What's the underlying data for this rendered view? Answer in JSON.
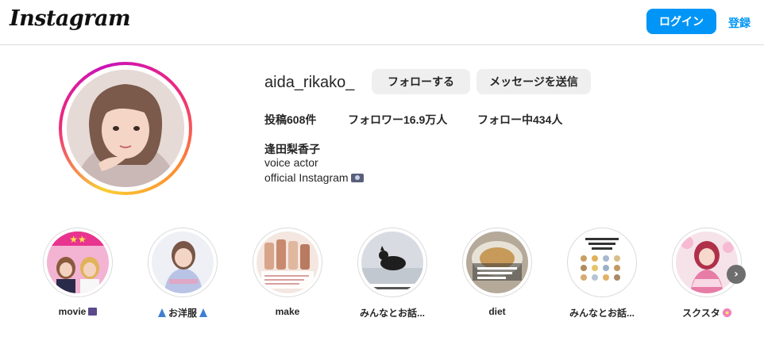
{
  "header": {
    "logo_text": "Instagram",
    "login_label": "ログイン",
    "signup_label": "登録",
    "accent_color": "#0095f6"
  },
  "profile": {
    "username": "aida_rikako_",
    "follow_label": "フォローする",
    "message_label": "メッセージを送信",
    "stats": {
      "posts": "投稿608件",
      "followers": "フォロワー16.9万人",
      "following": "フォロー中434人"
    },
    "full_name": "逢田梨香子",
    "bio_line1": "voice actor",
    "bio_line2": "official Instagram",
    "bio_icon": "camera-icon"
  },
  "highlights": [
    {
      "label": "movie",
      "emoji": "clapper-board-icon"
    },
    {
      "label": "お洋服",
      "emoji": "dress-icon"
    },
    {
      "label": "make",
      "emoji": ""
    },
    {
      "label": "みんなとお話...",
      "emoji": ""
    },
    {
      "label": "diet",
      "emoji": ""
    },
    {
      "label": "みんなとお話...",
      "emoji": ""
    },
    {
      "label": "スクスタ",
      "emoji": "flower-icon"
    }
  ],
  "highlights_next_icon": "chevron-right-icon"
}
